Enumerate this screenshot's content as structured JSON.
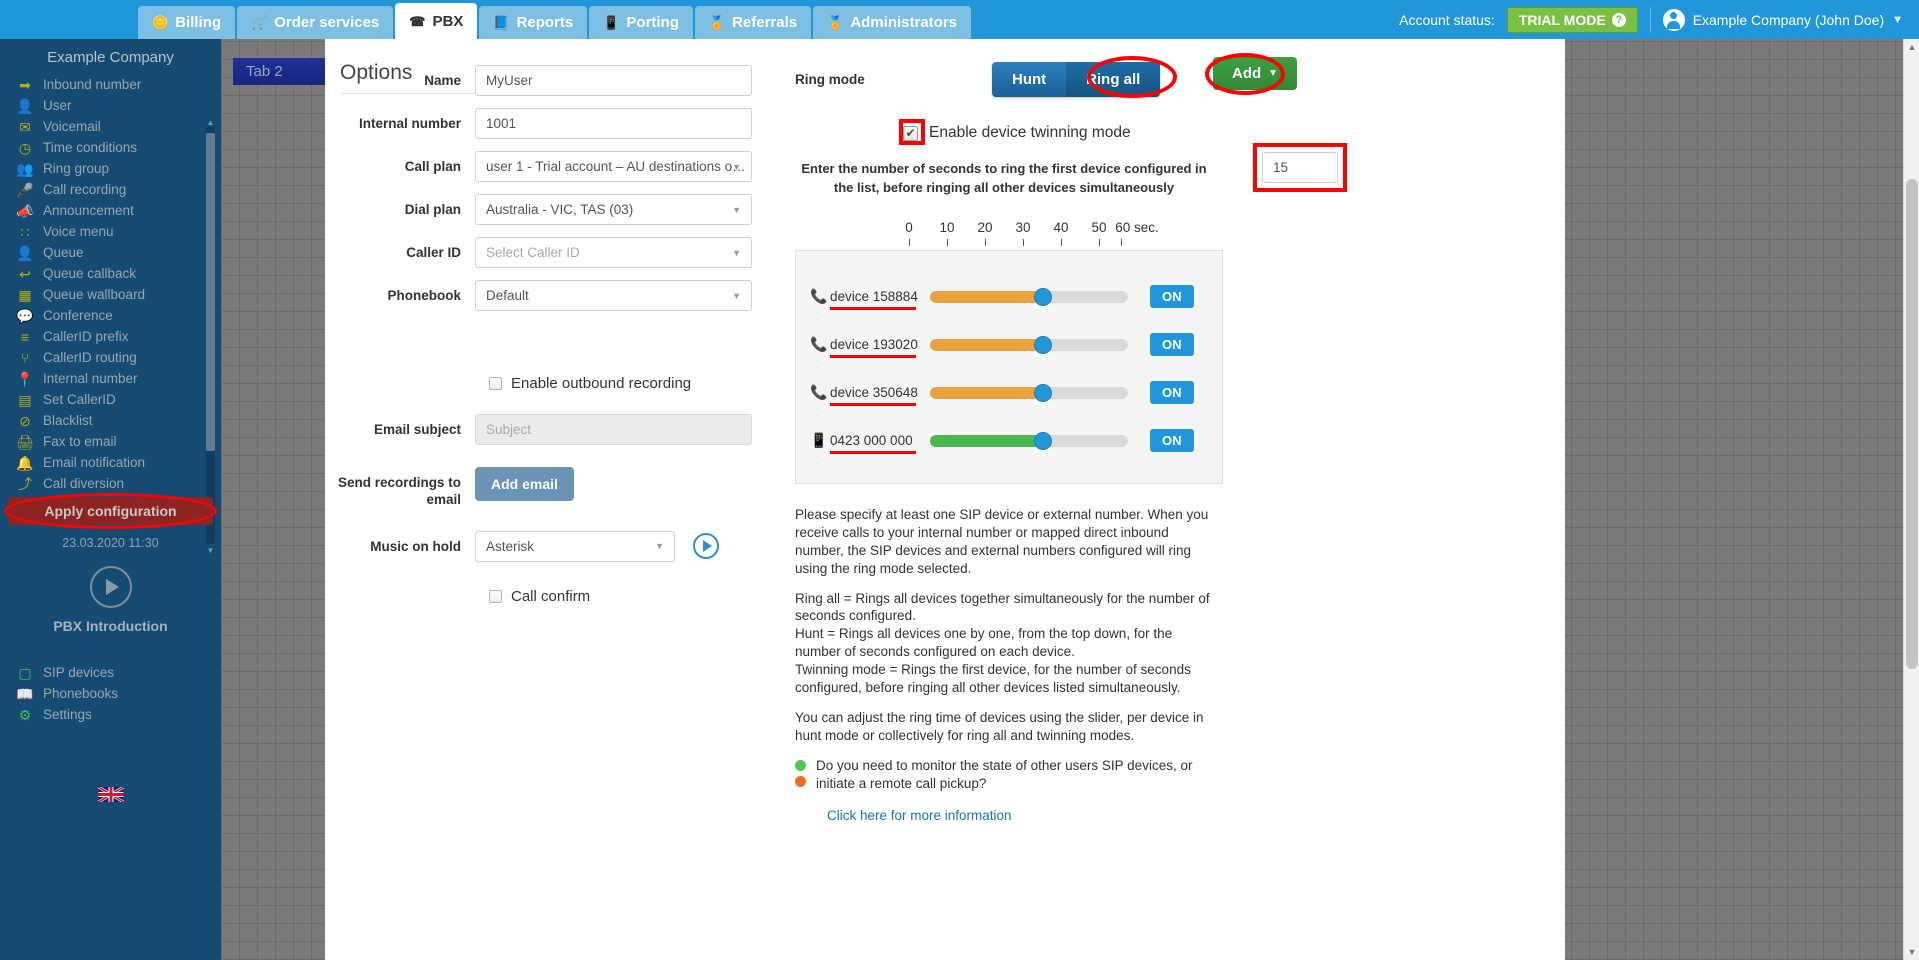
{
  "header": {
    "tabs": [
      {
        "label": "Billing",
        "icon": "coins-icon",
        "glyph": "🪙",
        "active": false
      },
      {
        "label": "Order services",
        "icon": "cart-icon",
        "glyph": "🛒",
        "active": false
      },
      {
        "label": "PBX",
        "icon": "pbx-icon",
        "glyph": "☎",
        "active": true
      },
      {
        "label": "Reports",
        "icon": "reports-icon",
        "glyph": "📘",
        "active": false
      },
      {
        "label": "Porting",
        "icon": "porting-icon",
        "glyph": "📱",
        "active": false
      },
      {
        "label": "Referrals",
        "icon": "referrals-icon",
        "glyph": "🏅",
        "active": false
      },
      {
        "label": "Administrators",
        "icon": "admins-icon",
        "glyph": "🏅",
        "active": false
      }
    ],
    "account_status_label": "Account status:",
    "trial_badge": "TRIAL MODE",
    "user_name": "Example Company (John Doe)"
  },
  "sidebar": {
    "company": "Example Company",
    "items": [
      {
        "label": "Inbound number",
        "icon": "arrow-right-icon",
        "glyph": "➡"
      },
      {
        "label": "User",
        "icon": "user-icon",
        "glyph": "👤"
      },
      {
        "label": "Voicemail",
        "icon": "envelope-icon",
        "glyph": "✉"
      },
      {
        "label": "Time conditions",
        "icon": "clock-icon",
        "glyph": "◷"
      },
      {
        "label": "Ring group",
        "icon": "users-icon",
        "glyph": "👥"
      },
      {
        "label": "Call recording",
        "icon": "microphone-icon",
        "glyph": "🎤"
      },
      {
        "label": "Announcement",
        "icon": "megaphone-icon",
        "glyph": "📣"
      },
      {
        "label": "Voice menu",
        "icon": "grid-icon",
        "glyph": "∷"
      },
      {
        "label": "Queue",
        "icon": "user-plus-icon",
        "glyph": "👤"
      },
      {
        "label": "Queue callback",
        "icon": "reply-arrow-icon",
        "glyph": "↩"
      },
      {
        "label": "Queue wallboard",
        "icon": "table-icon",
        "glyph": "▦"
      },
      {
        "label": "Conference",
        "icon": "chat-bubbles-icon",
        "glyph": "💬"
      },
      {
        "label": "CallerID prefix",
        "icon": "list-icon",
        "glyph": "≡"
      },
      {
        "label": "CallerID routing",
        "icon": "sitemap-icon",
        "glyph": "⑂"
      },
      {
        "label": "Internal number",
        "icon": "map-pin-icon",
        "glyph": "📍"
      },
      {
        "label": "Set CallerID",
        "icon": "id-card-icon",
        "glyph": "▤"
      },
      {
        "label": "Blacklist",
        "icon": "ban-icon",
        "glyph": "⊘"
      },
      {
        "label": "Fax to email",
        "icon": "fax-icon",
        "glyph": "🖨"
      },
      {
        "label": "Email notification",
        "icon": "bell-icon",
        "glyph": "🔔"
      },
      {
        "label": "Call diversion",
        "icon": "diversion-icon",
        "glyph": "⤴"
      }
    ],
    "apply_button": "Apply configuration",
    "date": "23.03.2020 11:30",
    "intro_label": "PBX Introduction",
    "bottom_items": [
      {
        "label": "SIP devices",
        "icon": "monitor-icon",
        "glyph": "▢"
      },
      {
        "label": "Phonebooks",
        "icon": "book-icon",
        "glyph": "📖"
      },
      {
        "label": "Settings",
        "icon": "gear-icon",
        "glyph": "⚙"
      }
    ],
    "flag": "uk-flag-icon"
  },
  "workspace": {
    "tab2_label": "Tab 2"
  },
  "form": {
    "fields": [
      {
        "label": "Name",
        "type": "input",
        "value": "MyUser",
        "placeholder": ""
      },
      {
        "label": "Internal number",
        "type": "input",
        "value": "1001",
        "placeholder": ""
      },
      {
        "label": "Call plan",
        "type": "select",
        "value": "user 1 - Trial account – AU destinations o…",
        "placeholder": ""
      },
      {
        "label": "Dial plan",
        "type": "select",
        "value": "Australia - VIC, TAS (03)",
        "placeholder": ""
      },
      {
        "label": "Caller ID",
        "type": "select",
        "value": "",
        "placeholder": "Select Caller ID"
      },
      {
        "label": "Phonebook",
        "type": "select",
        "value": "Default",
        "placeholder": ""
      }
    ],
    "options_heading": "Options",
    "enable_outbound_recording": "Enable outbound recording",
    "email_subject_label": "Email subject",
    "email_subject_placeholder": "Subject",
    "send_recordings_label": "Send recordings to email",
    "add_email_button": "Add email",
    "music_on_hold_label": "Music on hold",
    "music_on_hold_value": "Asterisk",
    "call_confirm_label": "Call confirm"
  },
  "ring": {
    "ring_mode_label": "Ring mode",
    "mode_hunt": "Hunt",
    "mode_ring_all": "Ring all",
    "add_button": "Add",
    "twinning_label": "Enable device twinning mode",
    "twinning_checked": true,
    "seconds_instruction": "Enter the number of seconds to ring the first device configured in the list, before ringing all other devices simultaneously",
    "seconds_value": "15",
    "scale_labels": [
      "0",
      "10",
      "20",
      "30",
      "40",
      "50",
      "60 sec."
    ],
    "devices": [
      {
        "name": "device 158884",
        "icon": "phone-icon",
        "glyph": "📞",
        "fill_color": "#eca13e",
        "value_pct": 57,
        "toggle": "ON"
      },
      {
        "name": "device 193020",
        "icon": "phone-icon",
        "glyph": "📞",
        "fill_color": "#eca13e",
        "value_pct": 57,
        "toggle": "ON"
      },
      {
        "name": "device 350648",
        "icon": "phone-icon",
        "glyph": "📞",
        "fill_color": "#eca13e",
        "value_pct": 57,
        "toggle": "ON"
      },
      {
        "name": "0423 000 000",
        "icon": "mobile-icon",
        "glyph": "📱",
        "fill_color": "#49b84f",
        "value_pct": 57,
        "toggle": "ON"
      }
    ]
  },
  "help": {
    "para1": "Please specify at least one SIP device or external number. When you receive calls to your internal number or mapped direct inbound number, the SIP devices and external numbers configured will ring using the ring mode selected.",
    "para2": "Ring all = Rings all devices together simultaneously for the number of seconds configured.\nHunt = Rings all devices one by one, from the top down, for the number of seconds configured on each device.\nTwinning mode = Rings the first device, for the number of seconds configured, before ringing all other devices listed simultaneously.",
    "para3": "You can adjust the ring time of devices using the slider, per device in hunt mode or collectively for ring all and twinning modes.",
    "bullet_text": "Do you need to monitor the state of other users SIP devices, or initiate a remote call pickup?",
    "link": "Click here for more information"
  }
}
